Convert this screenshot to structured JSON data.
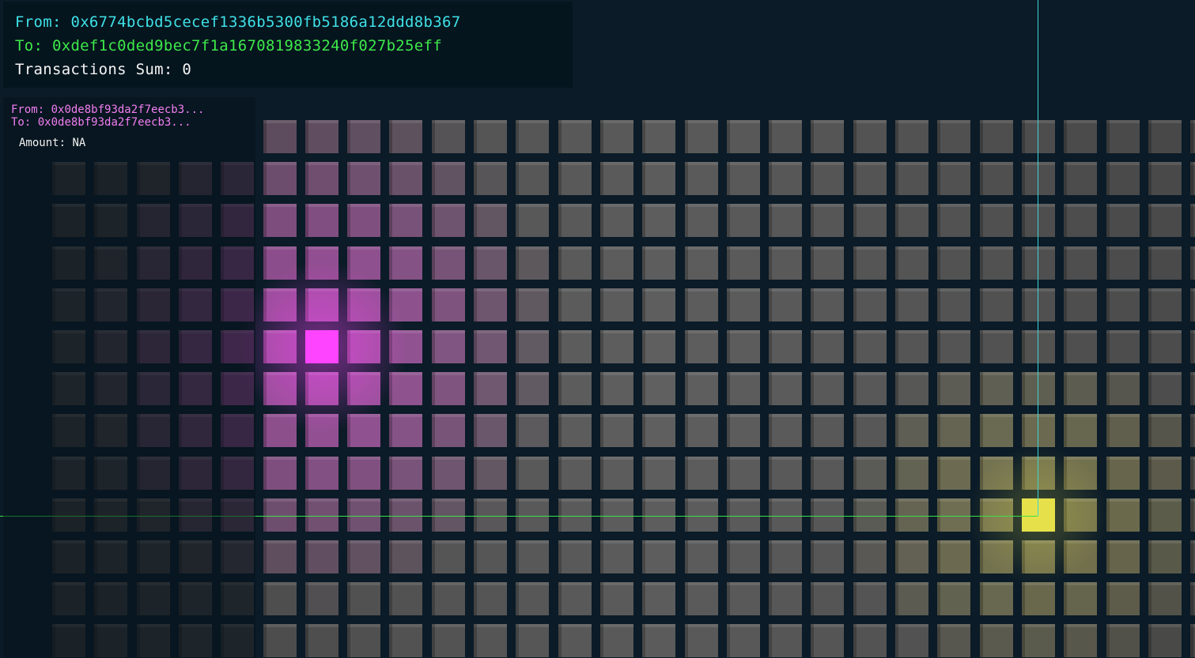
{
  "header_panel": {
    "from_label": "From:",
    "from_address": "0x6774bcbd5cecef1336b5300fb5186a12ddd8b367",
    "to_label": "To:",
    "to_address": "0xdef1c0ded9bec7f1a1670819833240f027b25eff",
    "sum_label": "Transactions Sum:",
    "sum_value": "0"
  },
  "tooltip": {
    "from_label": "From:",
    "from_address": "0x0de8bf93da2f7eecb3...",
    "to_label": "To:",
    "to_address": "0x0de8bf93da2f7eecb3...",
    "amount_label": "Amount:",
    "amount_value": "NA"
  },
  "grid": {
    "columns": 29,
    "rows": 13,
    "highlight_from": {
      "col": 6,
      "row": 5,
      "color": "#ff44ff"
    },
    "highlight_to": {
      "col": 23,
      "row": 9,
      "color": "#e6e14a"
    }
  },
  "colors": {
    "background": "#0b1b27",
    "from_cyan": "#3fe0e6",
    "to_green": "#3ee84a",
    "tooltip_pink": "#f27ef2",
    "crosshair_vertical": "#3ad6d6",
    "crosshair_horizontal": "#3be04a",
    "cube_base": "#5b5b5b"
  }
}
